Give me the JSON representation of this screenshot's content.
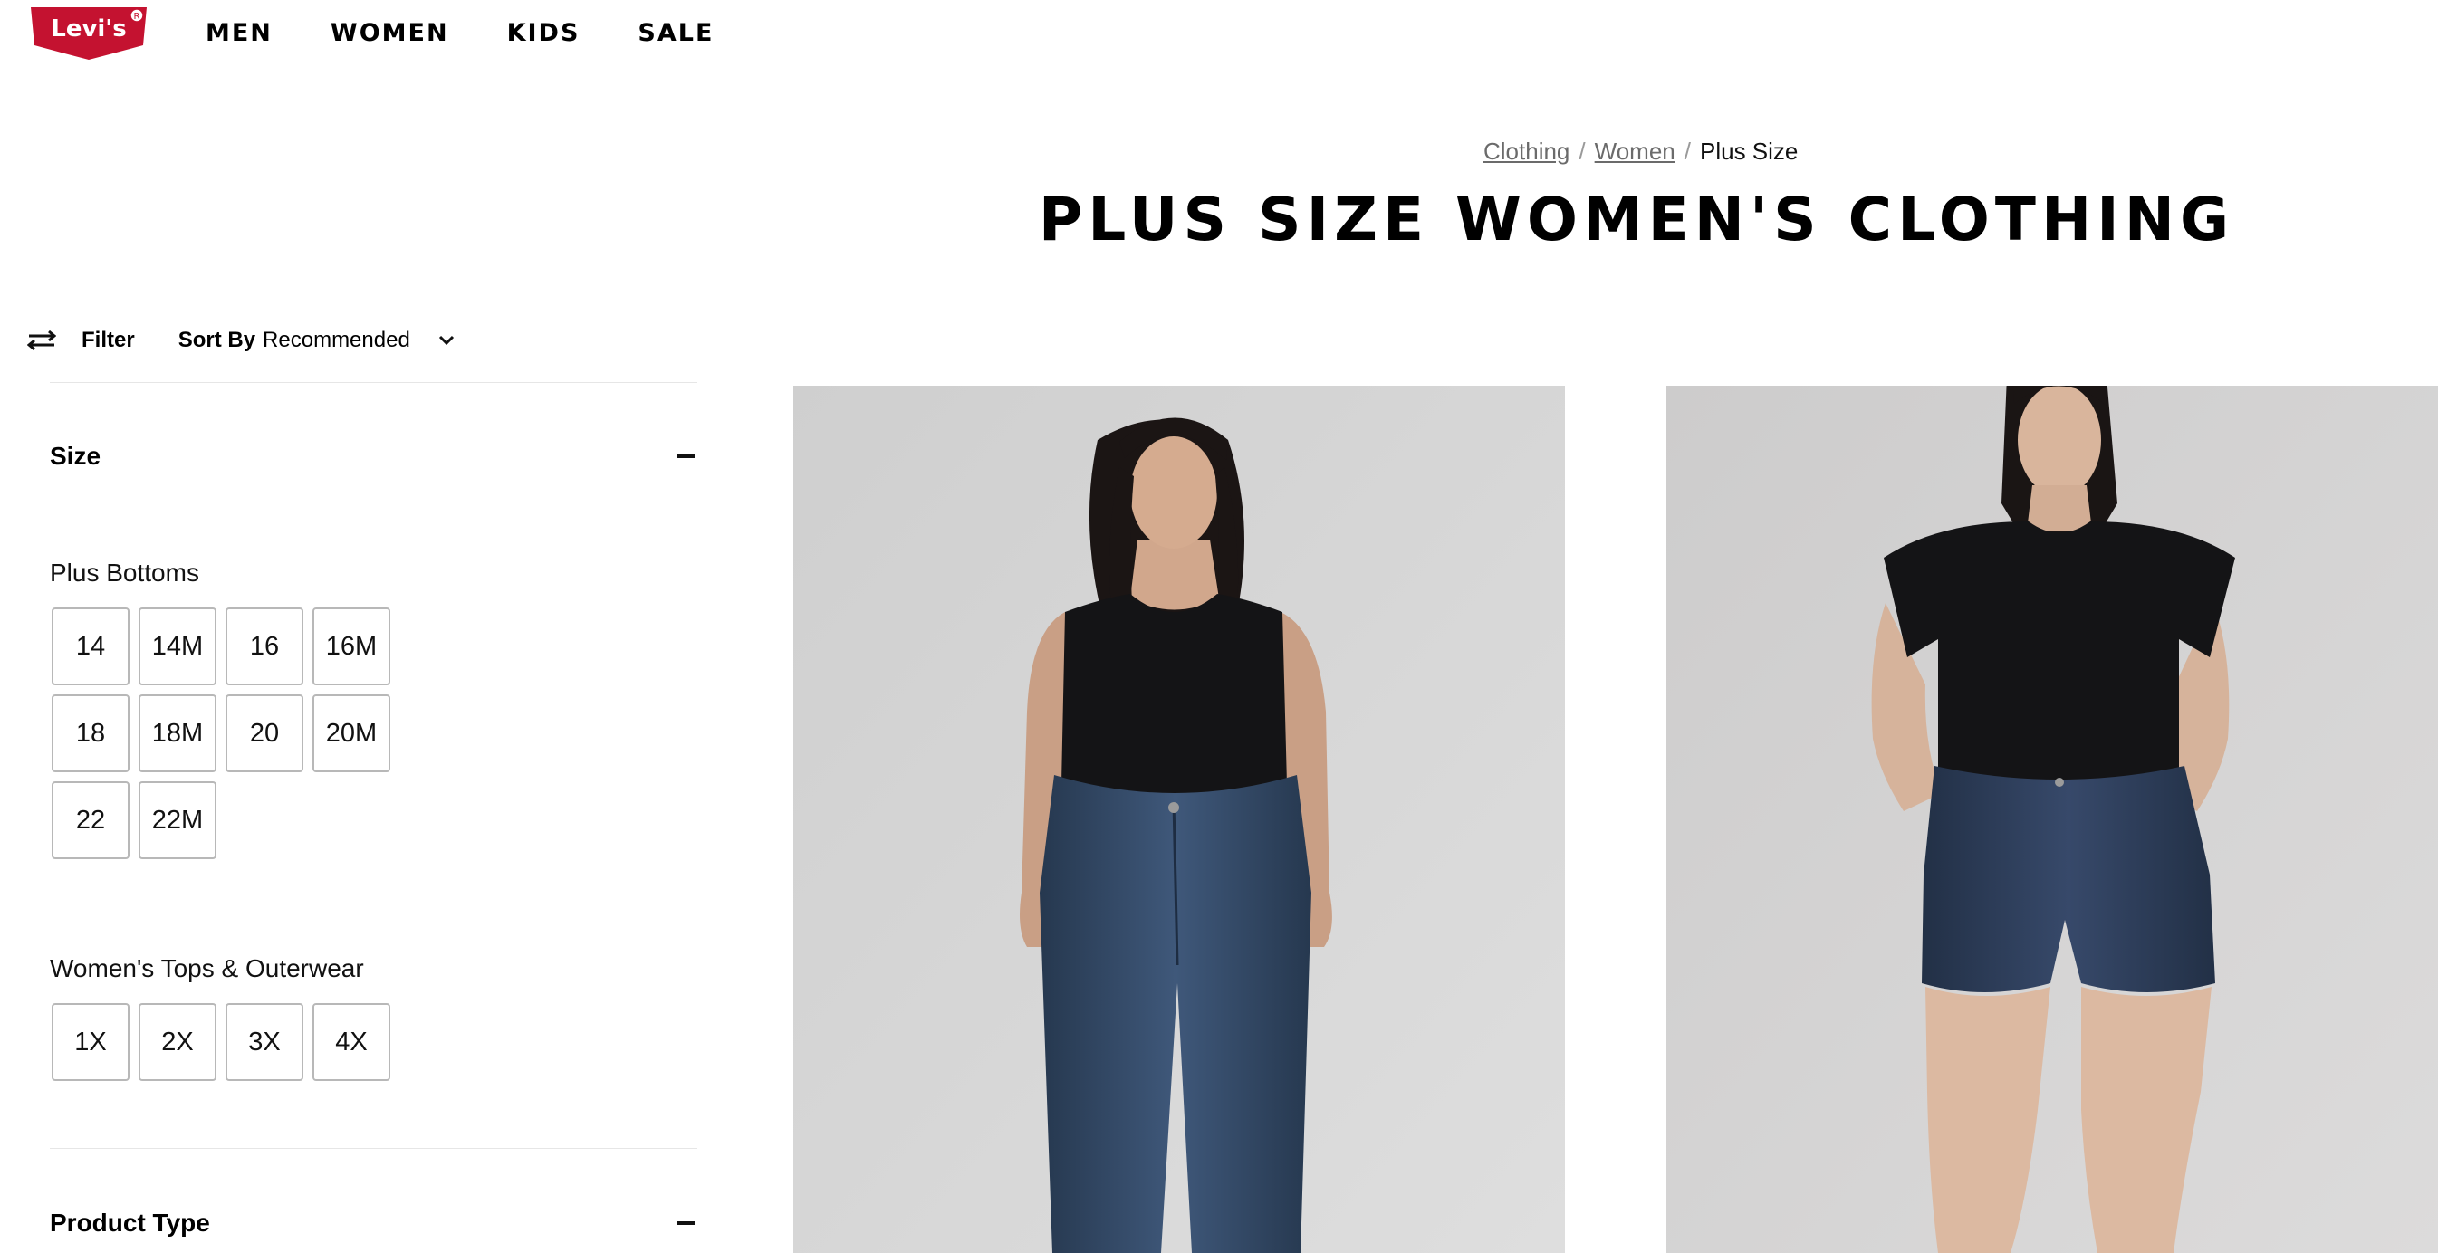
{
  "header": {
    "logo_text": "Levi's",
    "nav": [
      "MEN",
      "WOMEN",
      "KIDS",
      "SALE"
    ]
  },
  "breadcrumb": {
    "items": [
      "Clothing",
      "Women"
    ],
    "current": "Plus Size"
  },
  "page_title": "PLUS SIZE WOMEN'S CLOTHING",
  "toolbar": {
    "filter_label": "Filter",
    "sort_label": "Sort By",
    "sort_value": "Recommended"
  },
  "filters": {
    "size": {
      "title": "Size",
      "groups": [
        {
          "title": "Plus Bottoms",
          "sizes": [
            "14",
            "14M",
            "16",
            "16M",
            "18",
            "18M",
            "20",
            "20M",
            "22",
            "22M"
          ]
        },
        {
          "title": "Women's Tops & Outerwear",
          "sizes": [
            "1X",
            "2X",
            "3X",
            "4X"
          ]
        }
      ]
    },
    "product_type": {
      "title": "Product Type"
    }
  },
  "colors": {
    "brand_red": "#c41230",
    "photo_background": "#d6d6d6",
    "chip_border": "#b8b8b8"
  },
  "products": [
    {
      "image": "woman in black tank bodysuit and dark wash straight jeans"
    },
    {
      "image": "woman in black t-shirt bodysuit and dark wash denim shorts"
    }
  ]
}
